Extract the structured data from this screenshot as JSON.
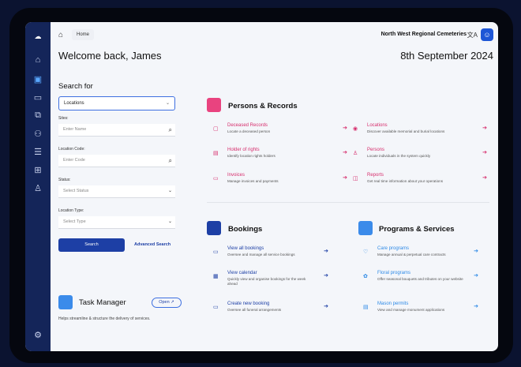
{
  "colors": {
    "sidebar": "#142559",
    "primary": "#1d3fa5",
    "pink": "#d62d6c",
    "light_blue": "#2e8ae6"
  },
  "sidebar": {
    "icons": [
      "logo-icon",
      "home-icon",
      "records-icon",
      "book-icon",
      "bookings-icon",
      "people-icon",
      "reports-icon",
      "locations-icon",
      "users-icon",
      "settings-icon"
    ]
  },
  "topbar": {
    "breadcrumb": "Home",
    "organisation": "North West Regional Cemeteries",
    "lang_icon": "文A"
  },
  "header": {
    "welcome": "Welcome back, James",
    "date": "8th September 2024"
  },
  "search": {
    "title": "Search for",
    "type_value": "Locations",
    "sites_label": "Sites:",
    "sites_placeholder": "Enter Name",
    "location_code_label": "Location Code:",
    "location_code_placeholder": "Enter Code",
    "status_label": "Status:",
    "status_placeholder": "Select Status",
    "location_type_label": "Location Type:",
    "location_type_placeholder": "Select Type",
    "search_button": "Search",
    "advanced_search": "Advanced Search"
  },
  "task_manager": {
    "title": "Task Manager",
    "open_button": "Open ↗",
    "description": "Helps streamline & structure the delivery of services."
  },
  "persons_records": {
    "title": "Persons & Records",
    "items": [
      {
        "title": "Deceased Records",
        "desc": "Locate a deceased person",
        "icon": "document-icon"
      },
      {
        "title": "Locations",
        "desc": "Discover available memorial and burial locations",
        "icon": "pin-icon"
      },
      {
        "title": "Holder of rights",
        "desc": "Identify location rights holders",
        "icon": "rights-icon"
      },
      {
        "title": "Persons",
        "desc": "Locate individuals in the system quickly",
        "icon": "person-icon"
      },
      {
        "title": "Invoices",
        "desc": "Manage invoices and payments",
        "icon": "invoice-icon"
      },
      {
        "title": "Reports",
        "desc": "Get real time information about your operations",
        "icon": "report-icon"
      }
    ]
  },
  "bookings": {
    "title": "Bookings",
    "items": [
      {
        "title": "View all bookings",
        "desc": "Oversee and manage all service bookings",
        "icon": "book-icon"
      },
      {
        "title": "View calendar",
        "desc": "Quickly view and organise bookings for the week ahead",
        "icon": "calendar-icon"
      },
      {
        "title": "Create new booking",
        "desc": "Oversee all funeral arrangements",
        "icon": "book-plus-icon"
      }
    ]
  },
  "programs": {
    "title": "Programs & Services",
    "items": [
      {
        "title": "Care programs",
        "desc": "Manage annual & perpetual care contracts",
        "icon": "care-icon"
      },
      {
        "title": "Floral programs",
        "desc": "Offer seasonal bouquets and tributes on your website",
        "icon": "flower-icon"
      },
      {
        "title": "Mason permits",
        "desc": "View and manage monument applications",
        "icon": "permit-icon"
      }
    ]
  }
}
